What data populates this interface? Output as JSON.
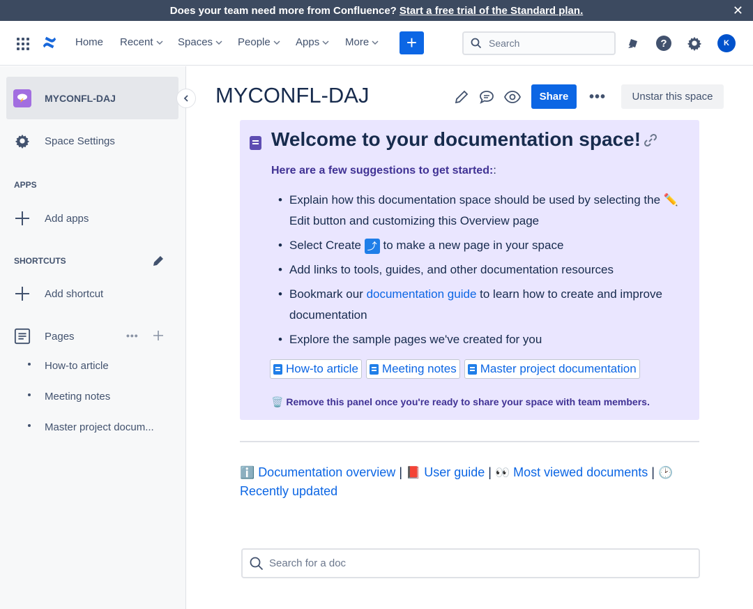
{
  "banner": {
    "text": "Does your team need more from Confluence?",
    "link": "Start a free trial of the Standard plan.",
    "close": "✕"
  },
  "nav": {
    "items": [
      {
        "label": "Home",
        "dropdown": false
      },
      {
        "label": "Recent",
        "dropdown": true
      },
      {
        "label": "Spaces",
        "dropdown": true
      },
      {
        "label": "People",
        "dropdown": true
      },
      {
        "label": "Apps",
        "dropdown": true
      },
      {
        "label": "More",
        "dropdown": true
      }
    ],
    "create_label": "+",
    "search_placeholder": "Search",
    "avatar_initial": "K"
  },
  "sidebar": {
    "space_name": "MYCONFL-DAJ",
    "space_settings": "Space Settings",
    "apps_heading": "APPS",
    "add_apps": "Add apps",
    "shortcuts_heading": "SHORTCUTS",
    "add_shortcut": "Add shortcut",
    "pages_label": "Pages",
    "pages": [
      "How-to article",
      "Meeting notes",
      "Master project docum..."
    ]
  },
  "page": {
    "title": "MYCONFL-DAJ",
    "share_label": "Share",
    "more_label": "•••",
    "unstar_label": "Unstar this space"
  },
  "panel": {
    "heading": "Welcome to your documentation space!",
    "intro": "Here are a few suggestions to get started:",
    "intro_suffix": ":",
    "bullets": {
      "b1_before": "Explain how this documentation space should be used by selecting the",
      "b1_emoji": "✏️",
      "b1_after": "Edit button and customizing this Overview page",
      "b2_before": "Select Create",
      "b2_emoji": "⤴",
      "b2_after": "to make a new page in your space",
      "b3": "Add links to tools, guides, and other documentation resources",
      "b4_before": "Bookmark our",
      "b4_link": "documentation guide",
      "b4_after": "to learn how to create and improve documentation",
      "b5": "Explore the sample pages we've created for you"
    },
    "chips": [
      "How-to article",
      "Meeting notes",
      "Master project documentation"
    ],
    "remove_emoji": "🗑️",
    "remove_note": "Remove this panel once you're ready to share your space with team members."
  },
  "quick_links": {
    "e1": "ℹ️",
    "l1": "Documentation overview",
    "e2": "📕",
    "l2": "User guide",
    "e3": "👀",
    "l3": "Most viewed documents",
    "e4": "🕑",
    "l4": "Recently updated",
    "sep": "|"
  },
  "doc_search": {
    "placeholder": "Search for a doc"
  }
}
